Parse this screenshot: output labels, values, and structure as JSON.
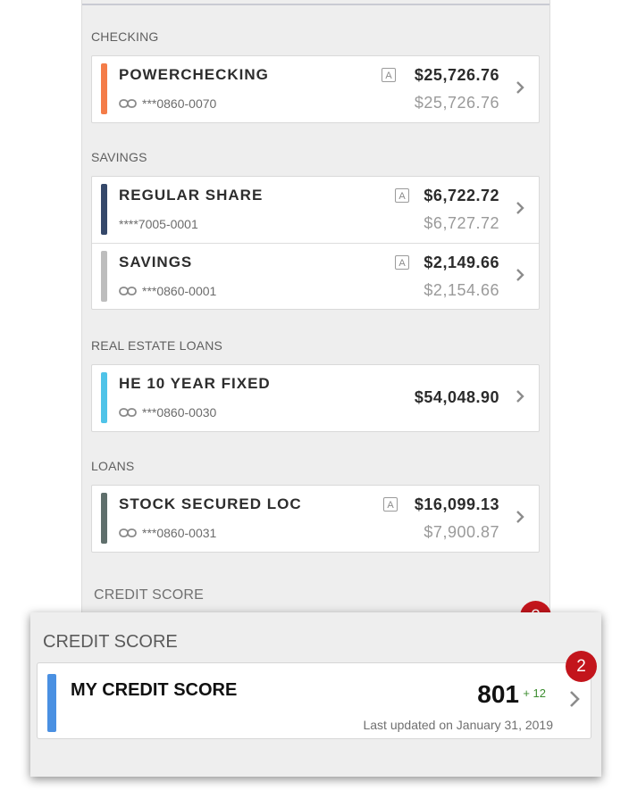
{
  "sections": {
    "checking": {
      "label": "CHECKING",
      "rows": [
        {
          "name": "POWERCHECKING",
          "acct": "***0860-0070",
          "amount_current": "$25,726.76",
          "amount_available": "$25,726.76",
          "badge": "A",
          "color": "#f47c48"
        }
      ]
    },
    "savings": {
      "label": "SAVINGS",
      "rows": [
        {
          "name": "REGULAR SHARE",
          "acct": "****7005-0001",
          "amount_current": "$6,722.72",
          "amount_available": "$6,727.72",
          "badge": "A",
          "color": "#35486a"
        },
        {
          "name": "SAVINGS",
          "acct": "***0860-0001",
          "amount_current": "$2,149.66",
          "amount_available": "$2,154.66",
          "badge": "A",
          "color": "#bdbdbd"
        }
      ]
    },
    "real_estate": {
      "label": "REAL ESTATE LOANS",
      "rows": [
        {
          "name": "HE 10 YEAR FIXED",
          "acct": "***0860-0030",
          "amount": "$54,048.90",
          "color": "#4fc3e8"
        }
      ]
    },
    "loans": {
      "label": "LOANS",
      "rows": [
        {
          "name": "STOCK SECURED LOC",
          "acct": "***0860-0031",
          "amount_current": "$16,099.13",
          "amount_available": "$7,900.87",
          "badge": "A",
          "color": "#5f6f6c"
        }
      ]
    },
    "credit_bg": {
      "label": "CREDIT SCORE",
      "badge": "2"
    }
  },
  "credit_overlay": {
    "title": "CREDIT SCORE",
    "name": "MY CREDIT SCORE",
    "score": "801",
    "delta": "+ 12",
    "updated": "Last updated on January 31, 2019",
    "badge": "2",
    "color": "#4a90e2"
  }
}
